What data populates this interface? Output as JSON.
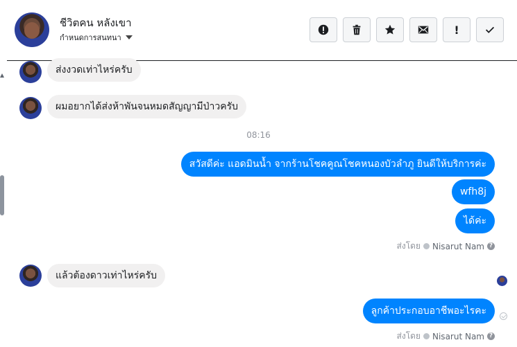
{
  "header": {
    "contact_name": "ชีวิตคน หลังเขา",
    "subtitle": "กำหนดการสนทนา",
    "actions": [
      {
        "icon": "alert-circle-icon",
        "label": ""
      },
      {
        "icon": "trash-icon",
        "label": ""
      },
      {
        "icon": "star-icon",
        "label": ""
      },
      {
        "icon": "envelope-icon",
        "label": ""
      },
      {
        "icon": "exclamation-icon",
        "label": "!"
      },
      {
        "icon": "checkmark-icon",
        "label": ""
      }
    ]
  },
  "messages": {
    "in_1": "ส่งงวดเท่าไหร่ครับ",
    "in_2": "ผมอยากได้ส่งห้าพันจนหมดสัญญามีป่าวครับ",
    "timestamp": "08:16",
    "out_1": "สวัสดีค่ะ แอดมินน้ำ จากร้านโชคคูณโชคหนองบัวลำภู ยินดีให้บริการค่ะ",
    "out_2": "wfh8j",
    "out_3": "ได้ค่ะ",
    "sent_by_1": {
      "prefix": "ส่งโดย",
      "name": "Nisarut Nam"
    },
    "in_3": "แล้วต้องดาวเท่าไหร่ครับ",
    "out_4": "ลูกค้าประกอบอาชีพอะไรคะ",
    "sent_by_2": {
      "prefix": "ส่งโดย",
      "name": "Nisarut Nam"
    }
  },
  "colors": {
    "outgoing": "#0084ff",
    "incoming": "#f1f0f0"
  }
}
